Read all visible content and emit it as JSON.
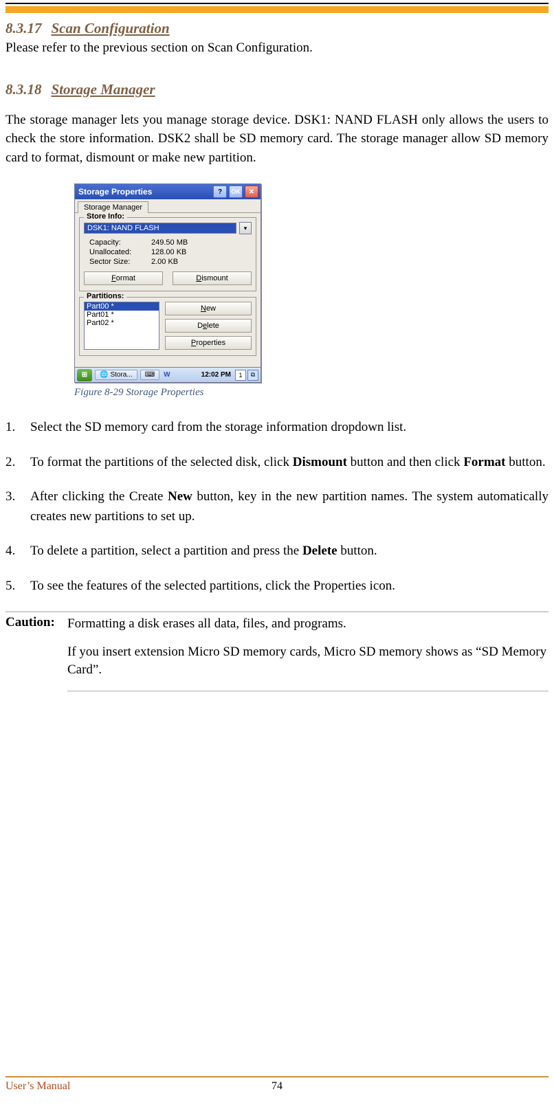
{
  "section1": {
    "number": "8.3.17",
    "title": "Scan Configuration"
  },
  "section1_text": "Please refer to the previous section on Scan Configuration.",
  "section2": {
    "number": "8.3.18",
    "title": "Storage Manager"
  },
  "section2_text": "The storage manager lets you manage storage device. DSK1: NAND FLASH only allows the users to check the store information. DSK2 shall be SD memory card. The storage manager allow SD memory card to format, dismount or make new partition.",
  "wince": {
    "window_title": "Storage Properties",
    "help": "?",
    "ok": "OK",
    "close": "✕",
    "tab": "Storage Manager",
    "store_info_label": "Store Info:",
    "combo_selected": "DSK1: NAND FLASH",
    "combo_arrow": "▾",
    "capacity_k": "Capacity:",
    "capacity_v": "249.50 MB",
    "unalloc_k": "Unallocated:",
    "unalloc_v": "128.00 KB",
    "sector_k": "Sector Size:",
    "sector_v": "2.00 KB",
    "format_btn": "Format",
    "dismount_btn": "Dismount",
    "partitions_label": "Partitions:",
    "parts": {
      "p0": "Part00 *",
      "p1": "Part01 *",
      "p2": "Part02 *"
    },
    "new_btn": "New",
    "delete_btn": "Delete",
    "properties_btn": "Properties",
    "start": "⊞",
    "task_label": "Stora...",
    "clock": "12:02 PM",
    "tray1": "1",
    "tray2": "⧉"
  },
  "figure_caption": "Figure 8-29 Storage Properties",
  "steps": {
    "s1": "Select the SD memory card from the storage information dropdown list.",
    "s2a": "To format the partitions of the selected disk, click ",
    "s2b": "Dismount",
    "s2c": " button and then click ",
    "s2d": "Format",
    "s2e": " button.",
    "s3a": "After clicking the Create ",
    "s3b": "New",
    "s3c": " button, key in the new partition names. The system automatically creates new partitions to set up.",
    "s4a": "To delete a partition, select a partition and press the ",
    "s4b": "Delete",
    "s4c": " button.",
    "s5": "To see the features of the selected partitions, click the Properties icon."
  },
  "caution": {
    "label": "Caution:",
    "p1": "Formatting a disk erases all data, files, and programs.",
    "p2": "If you insert extension Micro SD memory cards, Micro SD memory shows as “SD Memory Card”."
  },
  "footer": {
    "left": "User’s Manual",
    "page": "74"
  }
}
